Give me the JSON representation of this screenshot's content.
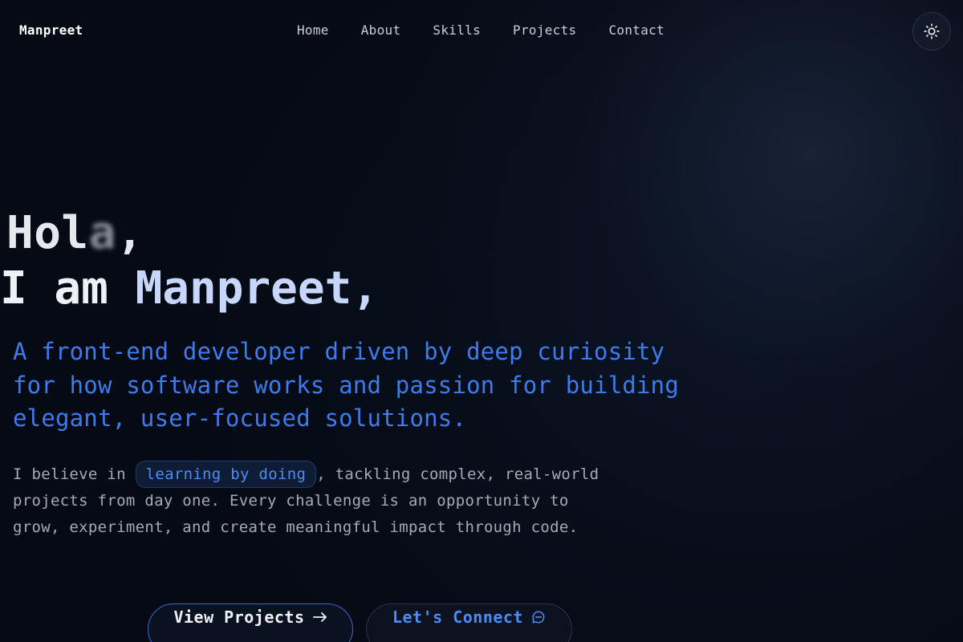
{
  "brand": "Manpreet",
  "nav": {
    "items": [
      "Home",
      "About",
      "Skills",
      "Projects",
      "Contact"
    ]
  },
  "theme_toggle": {
    "icon": "sun-icon"
  },
  "hero": {
    "greeting_visible": "Hol",
    "greeting_blurred": "a",
    "greeting_comma": ",",
    "intro_prefix": "I am ",
    "intro_name": "Manpreet,",
    "tagline": "A front-end developer driven by deep curiosity for how software works and passion for building elegant, user-focused solutions.",
    "desc_before": "I believe in",
    "desc_highlight": "learning by doing",
    "desc_after": ", tackling complex, real-world projects from day one. Every challenge is an opportunity to grow, experiment, and create meaningful impact through code."
  },
  "buttons": {
    "primary": {
      "label": "View Projects",
      "icon": "arrow-right-icon"
    },
    "secondary": {
      "label": "Let's Connect",
      "icon": "chat-bubble-icon"
    }
  },
  "colors": {
    "background": "#050a14",
    "accent": "#3d7bef",
    "name": "#c6d7fb"
  }
}
